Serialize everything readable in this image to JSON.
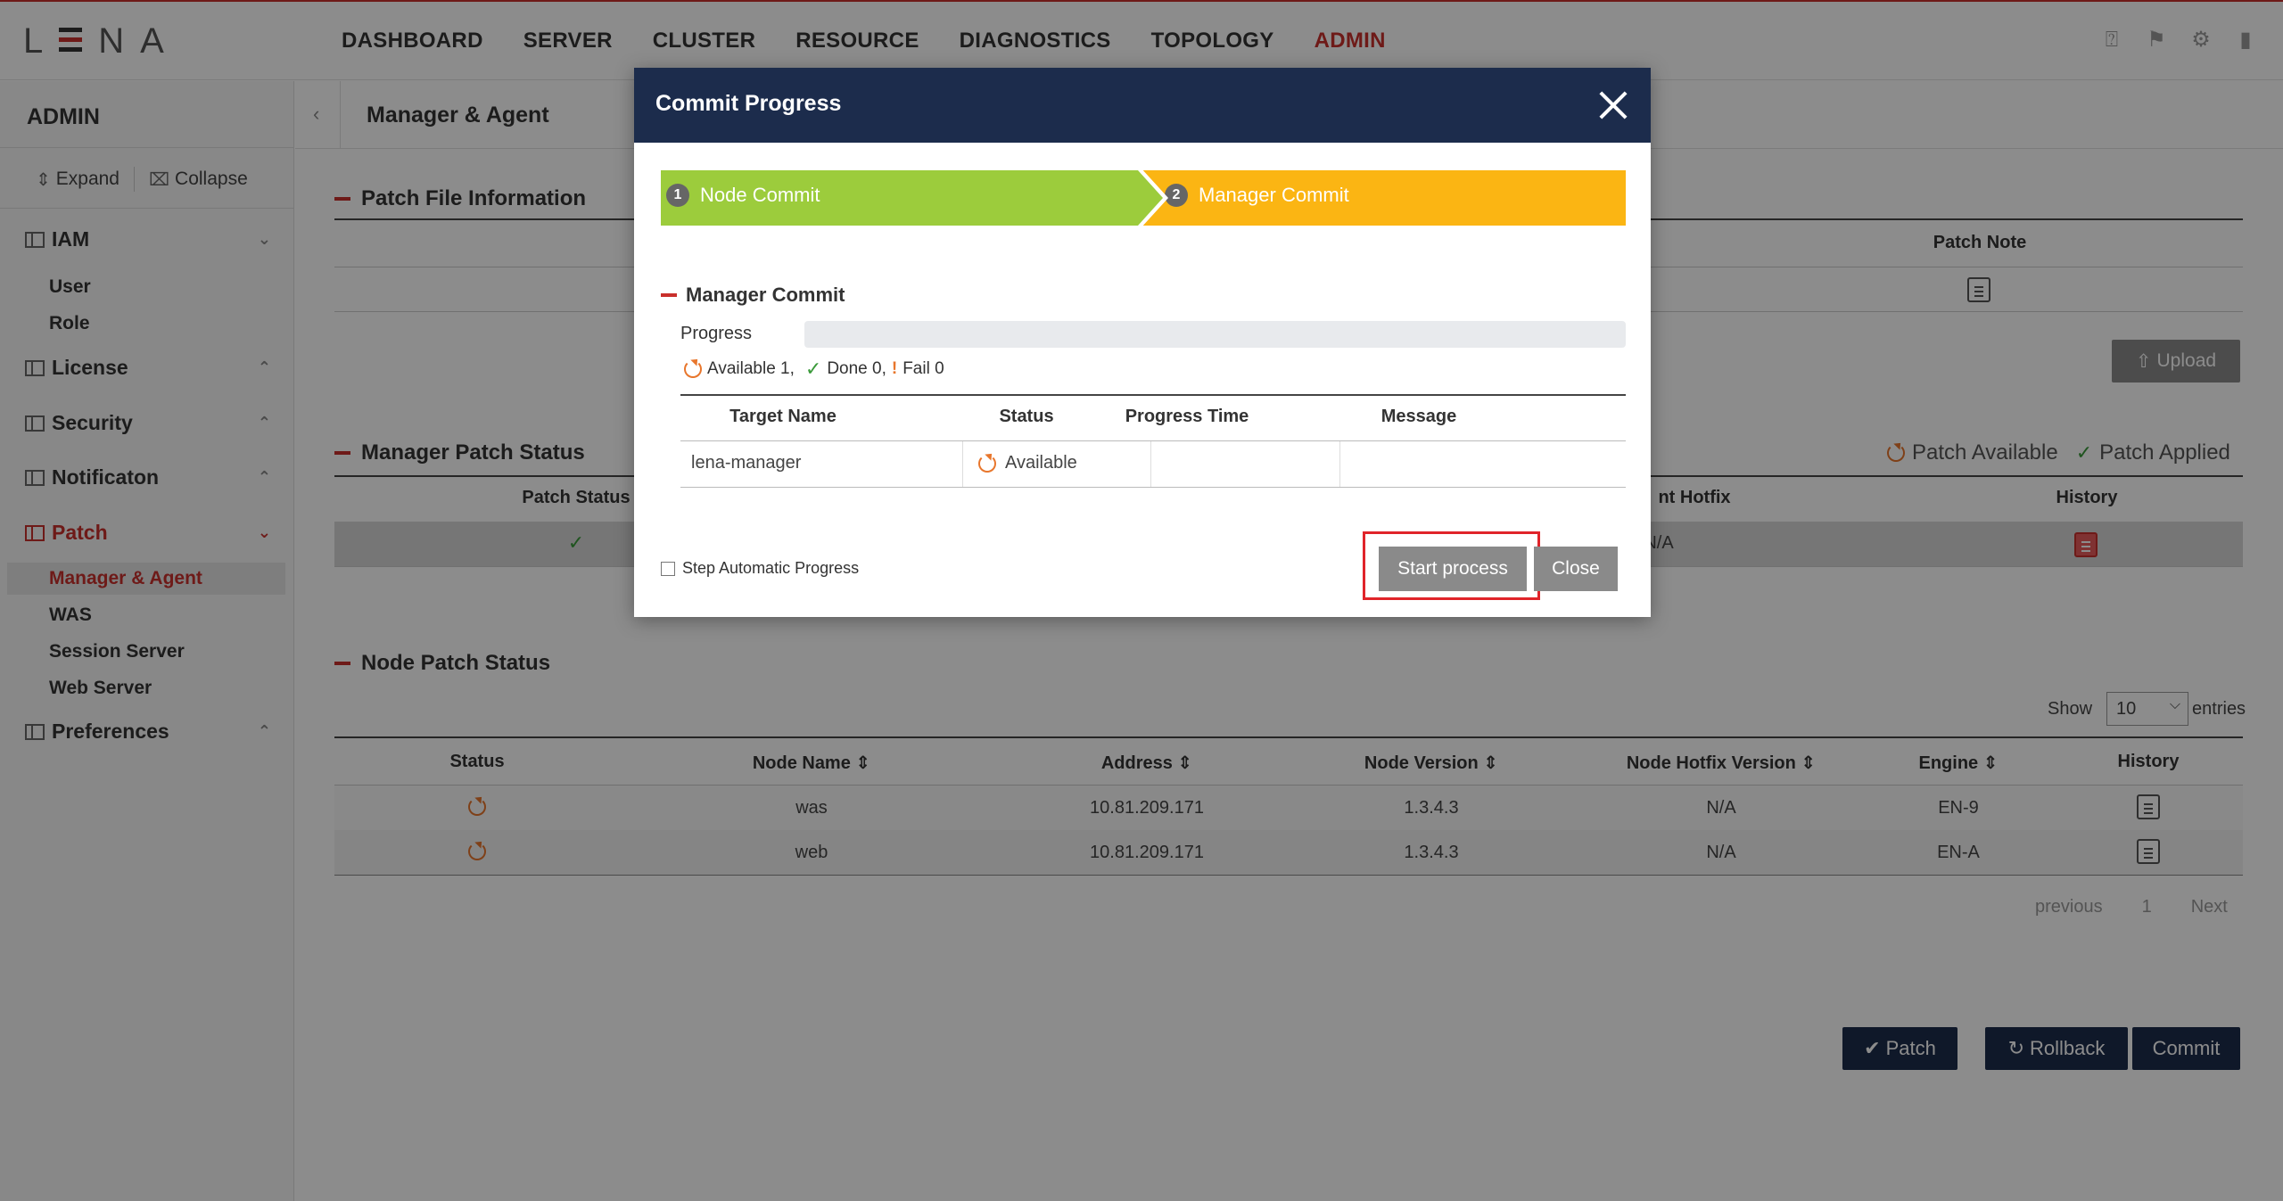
{
  "app": {
    "logo": "LENA",
    "nav": [
      "DASHBOARD",
      "SERVER",
      "CLUSTER",
      "RESOURCE",
      "DIAGNOSTICS",
      "TOPOLOGY",
      "ADMIN"
    ],
    "active_nav": "ADMIN",
    "accent_color": "#c9302c",
    "header_icons": [
      "help-icon",
      "bell-icon",
      "gear-icon",
      "logout-icon"
    ]
  },
  "sidebar": {
    "title": "ADMIN",
    "expand_label": "Expand",
    "collapse_label": "Collapse",
    "groups": [
      {
        "label": "IAM",
        "items": [
          "User",
          "Role"
        ]
      },
      {
        "label": "License",
        "items": []
      },
      {
        "label": "Security",
        "items": []
      },
      {
        "label": "Notificaton",
        "items": []
      },
      {
        "label": "Patch",
        "items": [
          "Manager & Agent",
          "WAS",
          "Session Server",
          "Web Server"
        ]
      },
      {
        "label": "Preferences",
        "items": []
      }
    ],
    "active_item": "Manager & Agent"
  },
  "main": {
    "breadcrumb": "Manager & Agent",
    "patch_file_section": "Patch File Information",
    "patch_file_col": "Patch Note",
    "upload_label": "Upload",
    "manager_patch_section": "Manager Patch Status",
    "legend_available": "Patch Available",
    "legend_applied": "Patch Applied",
    "manager_cols": {
      "status": "Patch Status",
      "hotfix": "nt Hotfix",
      "history": "History"
    },
    "manager_row": {
      "hotfix": "N/A"
    },
    "node_section": "Node Patch Status",
    "show_label": "Show",
    "entries_value": "10",
    "entries_label": "entries",
    "node_cols": [
      "Status",
      "Node Name",
      "Address",
      "Node Version",
      "Node Hotfix Version",
      "Engine",
      "History"
    ],
    "node_rows": [
      {
        "name": "was",
        "address": "10.81.209.171",
        "version": "1.3.4.3",
        "hotfix": "N/A",
        "engine": "EN-9"
      },
      {
        "name": "web",
        "address": "10.81.209.171",
        "version": "1.3.4.3",
        "hotfix": "N/A",
        "engine": "EN-A"
      }
    ],
    "pager": {
      "previous": "previous",
      "page": "1",
      "next": "Next"
    },
    "buttons": {
      "patch": "Patch",
      "rollback": "Rollback",
      "commit": "Commit"
    }
  },
  "modal": {
    "title": "Commit Progress",
    "steps": [
      {
        "num": "1",
        "label": "Node Commit",
        "color": "#9ccc3c"
      },
      {
        "num": "2",
        "label": "Manager Commit",
        "color": "#fbb513"
      }
    ],
    "section": "Manager Commit",
    "progress_label": "Progress",
    "progress_fraction": 0,
    "stats": {
      "available": "Available 1,",
      "done": "Done 0,",
      "fail": "Fail 0"
    },
    "table_cols": [
      "Target Name",
      "Status",
      "Progress Time",
      "Message"
    ],
    "table_row": {
      "target": "lena-manager",
      "status": "Available",
      "time": "",
      "message": ""
    },
    "step_auto_label": "Step Automatic Progress",
    "start_label": "Start process",
    "close_label": "Close"
  }
}
